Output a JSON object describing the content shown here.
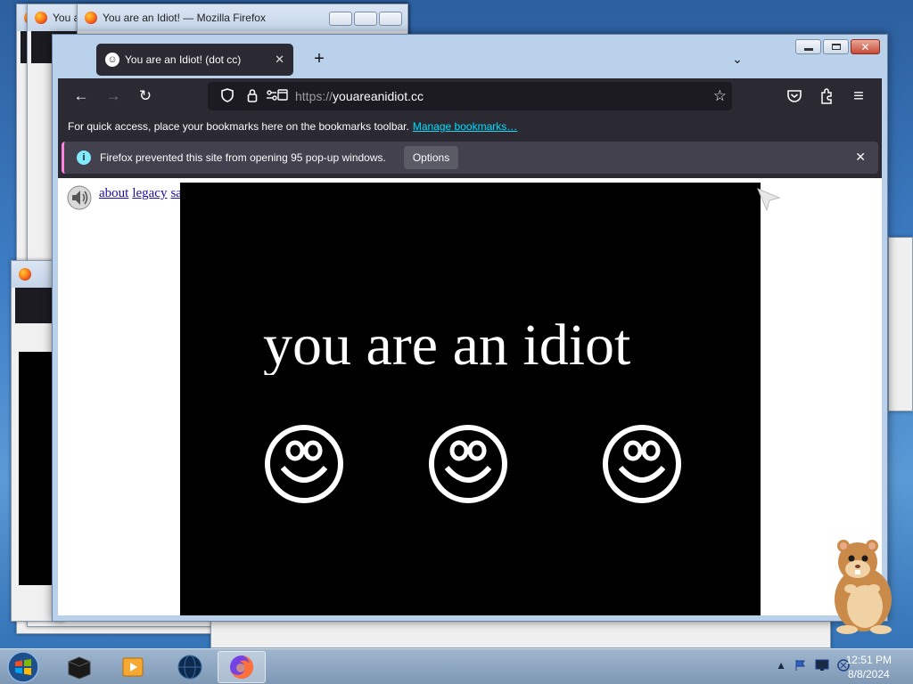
{
  "background_windows": {
    "title": "You are an Idiot! — Mozilla Firefox"
  },
  "tab": {
    "title": "You are an Idiot! (dot cc)",
    "close": "✕",
    "favicon": "☺"
  },
  "tabs": {
    "new_tab": "+",
    "list_all": "⌄"
  },
  "toolbar": {
    "back": "←",
    "forward": "→",
    "reload": "↻",
    "url_scheme": "https://",
    "url_host": "youareanidiot.cc",
    "star": "☆",
    "pocket": "◡",
    "extensions": "⧉",
    "menu": "≡"
  },
  "bookmarks_bar": {
    "text": "For quick access, place your bookmarks here on the bookmarks toolbar.",
    "link": "Manage bookmarks…"
  },
  "notification": {
    "info": "i",
    "text": "Firefox prevented this site from opening 95 pop-up windows.",
    "options": "Options",
    "close": "✕"
  },
  "page": {
    "links": [
      "about",
      "legacy",
      "safe"
    ],
    "headline": "you are an idiot",
    "smiley_count": 3
  },
  "clock": {
    "time": "12:51 PM",
    "date": "8/8/2024"
  },
  "colors": {
    "firefox_toolbar": "#2b2a33",
    "urlbar": "#1c1b22",
    "notification_bg": "#42414d",
    "link": "#00ddff"
  }
}
